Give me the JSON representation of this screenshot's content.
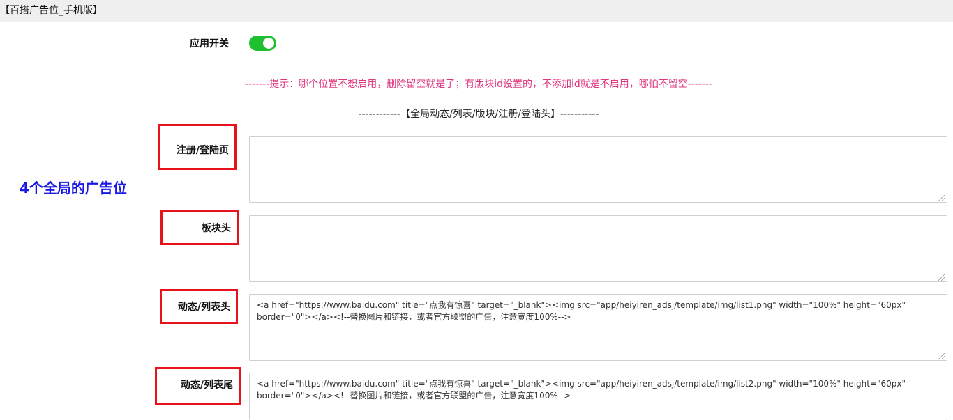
{
  "window": {
    "title": "【百搭广告位_手机版】"
  },
  "settings": {
    "switch_label": "应用开关",
    "switch_on": true,
    "accent_color": "#1ec02f"
  },
  "tip_text": "-------提示：哪个位置不想启用，删除留空就是了；有版块id设置的，不添加id就是不启用，哪怕不留空-------",
  "section_title": "------------【全局动态/列表/版块/注册/登陆头】-----------",
  "annotation": {
    "side_note": "4个全局的广告位",
    "highlight_color": "#e8121c",
    "note_color": "#1a1ae6"
  },
  "fields": [
    {
      "label": "注册/登陆页",
      "value": ""
    },
    {
      "label": "板块头",
      "value": ""
    },
    {
      "label": "动态/列表头",
      "value": "<a href=\"https://www.baidu.com\" title=\"点我有惊喜\" target=\"_blank\"><img src=\"app/heiyiren_adsj/template/img/list1.png\" width=\"100%\" height=\"60px\" border=\"0\"></a><!--替换图片和链接，或者官方联盟的广告，注意宽度100%-->"
    },
    {
      "label": "动态/列表尾",
      "value": "<a href=\"https://www.baidu.com\" title=\"点我有惊喜\" target=\"_blank\"><img src=\"app/heiyiren_adsj/template/img/list2.png\" width=\"100%\" height=\"60px\" border=\"0\"></a><!--替换图片和链接，或者官方联盟的广告，注意宽度100%-->"
    }
  ]
}
